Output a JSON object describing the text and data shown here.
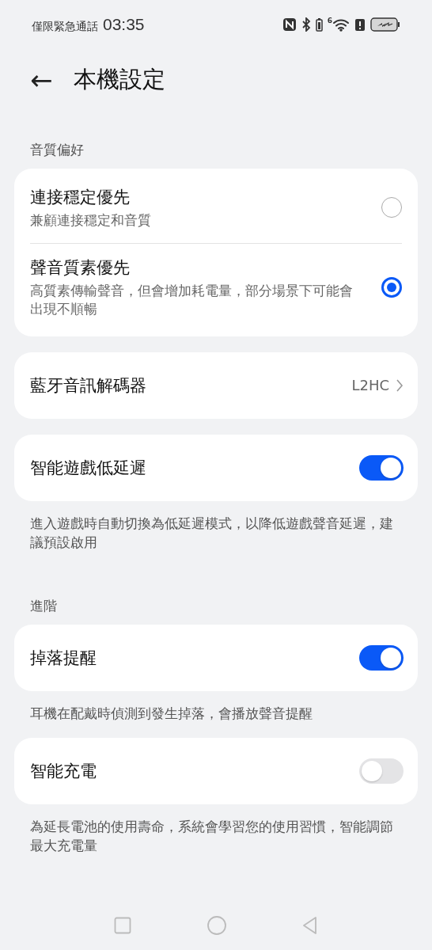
{
  "status_bar": {
    "carrier": "僅限緊急通話",
    "time": "03:35",
    "wifi_badge": "6"
  },
  "header": {
    "back": "←",
    "title": "本機設定"
  },
  "blocks": [
    {
      "kind": "section",
      "label": "音質偏好"
    },
    {
      "kind": "radios",
      "options": [
        {
          "title": "連接穩定優先",
          "subtitle": "兼顧連接穩定和音質",
          "selected": false
        },
        {
          "title": "聲音質素優先",
          "subtitle": "高質素傳輸聲音，但會增加耗電量，部分場景下可能會出現不順暢",
          "selected": true
        }
      ]
    },
    {
      "kind": "link",
      "title": "藍牙音訊解碼器",
      "value": "L2HC"
    },
    {
      "kind": "toggle",
      "title": "智能遊戲低延遲",
      "on": true
    },
    {
      "kind": "note",
      "text": "進入遊戲時自動切換為低延遲模式，以降低遊戲聲音延遲，建議預設啟用"
    },
    {
      "kind": "section",
      "label": "進階"
    },
    {
      "kind": "toggle",
      "title": "掉落提醒",
      "on": true
    },
    {
      "kind": "note",
      "text": "耳機在配戴時偵測到發生掉落，會播放聲音提醒"
    },
    {
      "kind": "toggle",
      "title": "智能充電",
      "on": false
    },
    {
      "kind": "note",
      "text": "為延長電池的使用壽命，系統會學習您的使用習慣，智能調節最大充電量"
    }
  ]
}
